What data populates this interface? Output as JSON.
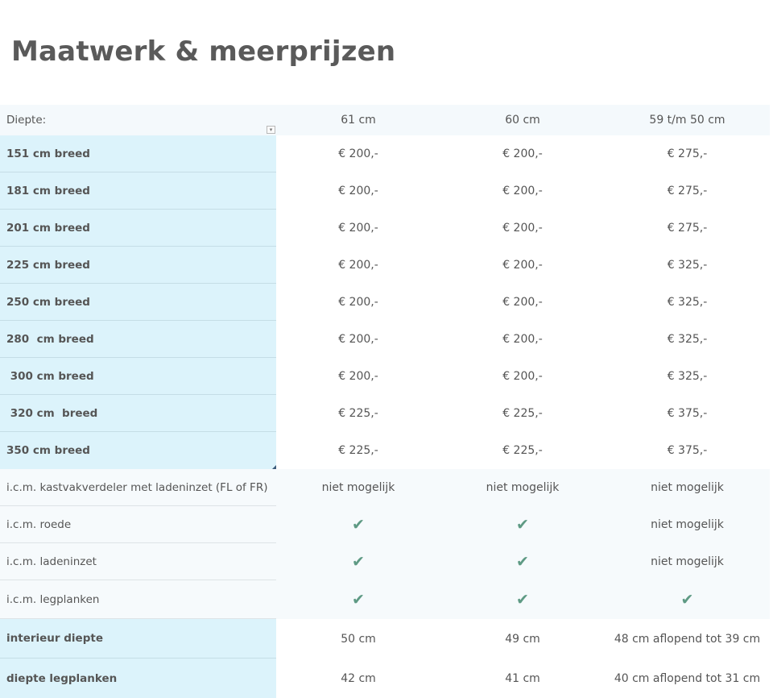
{
  "page": {
    "title": "Maatwerk & meerprijzen"
  },
  "table": {
    "header": {
      "label": "Diepte:",
      "cols": [
        "61 cm",
        "60 cm",
        "59 t/m 50 cm"
      ]
    },
    "width_rows": [
      {
        "label": "151 cm breed",
        "values": [
          "€ 200,-",
          "€ 200,-",
          "€ 275,-"
        ]
      },
      {
        "label": "181 cm breed",
        "values": [
          "€ 200,-",
          "€ 200,-",
          "€ 275,-"
        ]
      },
      {
        "label": "201 cm breed",
        "values": [
          "€ 200,-",
          "€ 200,-",
          "€ 275,-"
        ]
      },
      {
        "label": "225 cm breed",
        "values": [
          "€ 200,-",
          "€ 200,-",
          "€ 325,-"
        ]
      },
      {
        "label": "250 cm breed",
        "values": [
          "€ 200,-",
          "€ 200,-",
          "€ 325,-"
        ]
      },
      {
        "label": "280  cm breed",
        "values": [
          "€ 200,-",
          "€ 200,-",
          "€ 325,-"
        ]
      },
      {
        "label": " 300 cm breed",
        "values": [
          "€ 200,-",
          "€ 200,-",
          "€ 325,-"
        ]
      },
      {
        "label": " 320 cm  breed",
        "values": [
          "€ 225,-",
          "€ 225,-",
          "€ 375,-"
        ]
      },
      {
        "label": "350 cm breed",
        "values": [
          "€ 225,-",
          "€ 225,-",
          "€ 375,-"
        ]
      }
    ],
    "option_rows": [
      {
        "label": "i.c.m. kastvakverdeler met ladeninzet (FL of FR)",
        "values": [
          "niet mogelijk",
          "niet mogelijk",
          "niet mogelijk"
        ]
      },
      {
        "label": "i.c.m. roede",
        "values": [
          "✔",
          "✔",
          "niet mogelijk"
        ]
      },
      {
        "label": "i.c.m. ladeninzet",
        "values": [
          "✔",
          "✔",
          "niet mogelijk"
        ]
      },
      {
        "label": "i.c.m. legplanken",
        "values": [
          "✔",
          "✔",
          "✔"
        ]
      }
    ],
    "depth_rows": [
      {
        "label": "interieur diepte",
        "values": [
          "50 cm",
          "49 cm",
          "48 cm aflopend tot 39 cm"
        ]
      },
      {
        "label": "diepte legplanken",
        "values": [
          "42 cm",
          "41 cm",
          "40 cm aflopend tot 31 cm"
        ]
      }
    ]
  },
  "icons": {
    "check": "check-icon",
    "dropdown": "chevron-down-icon"
  },
  "colors": {
    "label_bg": "#dcf3fb",
    "header_bg": "#f4f9fc",
    "check": "#5e9a84"
  }
}
